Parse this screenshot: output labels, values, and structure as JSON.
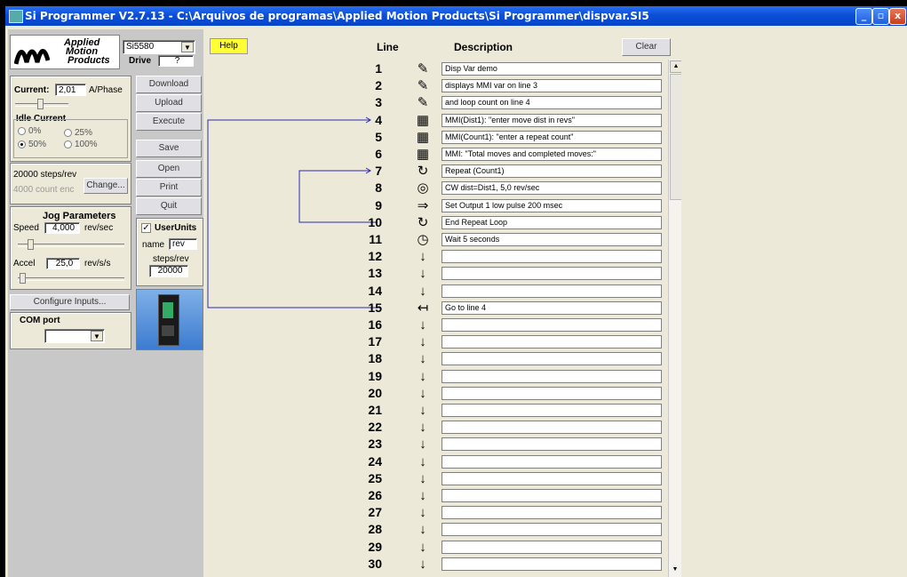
{
  "window": {
    "title": "Si Programmer  V2.7.13 - C:\\Arquivos de programas\\Applied Motion Products\\Si Programmer\\dispvar.SI5",
    "min_glyph": "_",
    "max_glyph": "▫",
    "close_glyph": "x"
  },
  "logo": {
    "line1": "Applied",
    "line2": "Motion",
    "line3": "Products"
  },
  "drive": {
    "model": "Si5580",
    "label": "Drive",
    "value": "?"
  },
  "current": {
    "label": "Current:",
    "value": "2,01",
    "unit": "A/Phase"
  },
  "idle_current": {
    "title": "Idle Current",
    "options": [
      {
        "label": "0%",
        "selected": false
      },
      {
        "label": "25%",
        "selected": false
      },
      {
        "label": "50%",
        "selected": true
      },
      {
        "label": "100%",
        "selected": false
      }
    ]
  },
  "side_buttons": {
    "download": "Download",
    "upload": "Upload",
    "execute": "Execute",
    "save": "Save",
    "open": "Open",
    "print": "Print",
    "quit": "Quit"
  },
  "steps": {
    "steps_rev": "20000 steps/rev",
    "count_enc": "4000 count enc",
    "change": "Change..."
  },
  "jog": {
    "title": "Jog Parameters",
    "speed_label": "Speed",
    "speed_value": "4,000",
    "speed_unit": "rev/sec",
    "accel_label": "Accel",
    "accel_value": "25,0",
    "accel_unit": "rev/s/s"
  },
  "user_units": {
    "check_label": "UserUnits",
    "checked_glyph": "✓",
    "name_label": "name",
    "name_value": "rev",
    "steps_label": "steps/rev",
    "steps_value": "20000"
  },
  "configure_inputs": "Configure Inputs...",
  "com_port": {
    "label": "COM port",
    "value": ""
  },
  "toolbar": {
    "help": "Help",
    "clear": "Clear"
  },
  "headers": {
    "line": "Line",
    "description": "Description"
  },
  "program": [
    {
      "n": "1",
      "icon": "comment-icon",
      "glyph": "✎",
      "desc": "Disp Var demo"
    },
    {
      "n": "2",
      "icon": "comment-icon",
      "glyph": "✎",
      "desc": "displays MMI var on line 3"
    },
    {
      "n": "3",
      "icon": "comment-icon",
      "glyph": "✎",
      "desc": "and loop count on line 4"
    },
    {
      "n": "4",
      "icon": "mmi-icon",
      "glyph": "▦",
      "desc": "MMI(Dist1): \"enter move dist in  revs\""
    },
    {
      "n": "5",
      "icon": "mmi-icon",
      "glyph": "▦",
      "desc": "MMI(Count1): \"enter a repeat count\""
    },
    {
      "n": "6",
      "icon": "mmi-icon",
      "glyph": "▦",
      "desc": "MMI: \"Total moves and     completed moves:\""
    },
    {
      "n": "7",
      "icon": "repeat-icon",
      "glyph": "↻",
      "desc": "Repeat (Count1)"
    },
    {
      "n": "8",
      "icon": "move-icon",
      "glyph": "◎",
      "desc": "CW dist=Dist1, 5,0 rev/sec"
    },
    {
      "n": "9",
      "icon": "output-icon",
      "glyph": "⇒",
      "desc": "Set Output 1 low pulse 200 msec"
    },
    {
      "n": "10",
      "icon": "repeat-icon",
      "glyph": "↻",
      "desc": "End Repeat Loop"
    },
    {
      "n": "11",
      "icon": "clock-icon",
      "glyph": "◷",
      "desc": "Wait 5 seconds"
    },
    {
      "n": "12",
      "icon": "arrow-down-icon",
      "glyph": "↓",
      "desc": ""
    },
    {
      "n": "13",
      "icon": "arrow-down-icon",
      "glyph": "↓",
      "desc": ""
    },
    {
      "n": "14",
      "icon": "arrow-down-icon",
      "glyph": "↓",
      "desc": ""
    },
    {
      "n": "15",
      "icon": "goto-icon",
      "glyph": "↤",
      "desc": "Go to line 4"
    },
    {
      "n": "16",
      "icon": "arrow-down-icon",
      "glyph": "↓",
      "desc": ""
    },
    {
      "n": "17",
      "icon": "arrow-down-icon",
      "glyph": "↓",
      "desc": ""
    },
    {
      "n": "18",
      "icon": "arrow-down-icon",
      "glyph": "↓",
      "desc": ""
    },
    {
      "n": "19",
      "icon": "arrow-down-icon",
      "glyph": "↓",
      "desc": ""
    },
    {
      "n": "20",
      "icon": "arrow-down-icon",
      "glyph": "↓",
      "desc": ""
    },
    {
      "n": "21",
      "icon": "arrow-down-icon",
      "glyph": "↓",
      "desc": ""
    },
    {
      "n": "22",
      "icon": "arrow-down-icon",
      "glyph": "↓",
      "desc": ""
    },
    {
      "n": "23",
      "icon": "arrow-down-icon",
      "glyph": "↓",
      "desc": ""
    },
    {
      "n": "24",
      "icon": "arrow-down-icon",
      "glyph": "↓",
      "desc": ""
    },
    {
      "n": "25",
      "icon": "arrow-down-icon",
      "glyph": "↓",
      "desc": ""
    },
    {
      "n": "26",
      "icon": "arrow-down-icon",
      "glyph": "↓",
      "desc": ""
    },
    {
      "n": "27",
      "icon": "arrow-down-icon",
      "glyph": "↓",
      "desc": ""
    },
    {
      "n": "28",
      "icon": "arrow-down-icon",
      "glyph": "↓",
      "desc": ""
    },
    {
      "n": "29",
      "icon": "arrow-down-icon",
      "glyph": "↓",
      "desc": ""
    },
    {
      "n": "30",
      "icon": "arrow-down-icon",
      "glyph": "↓",
      "desc": ""
    }
  ],
  "scroll_glyphs": {
    "up": "▲",
    "down": "▼"
  },
  "colors": {
    "link_line": "#2a2ab4",
    "title_bar": "#0a4fd8",
    "help": "#ffff33"
  }
}
